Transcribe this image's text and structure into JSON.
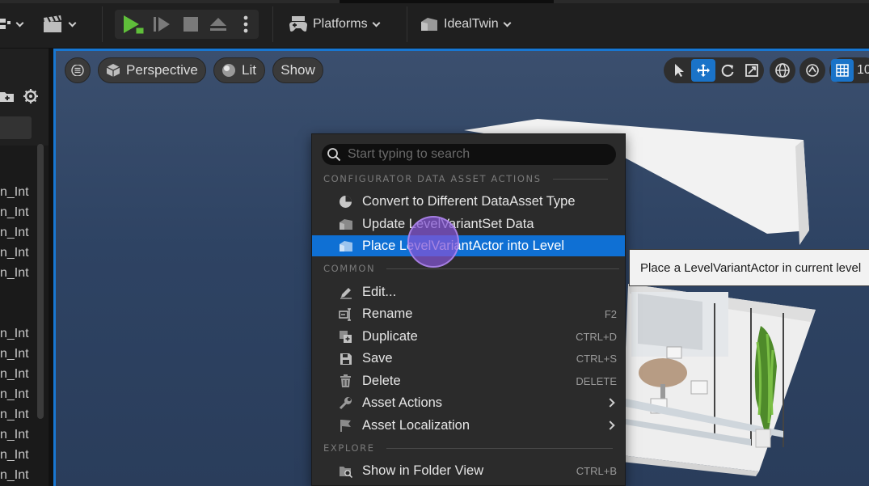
{
  "toolbar": {
    "platforms_label": "Platforms",
    "project_label": "IdealTwin"
  },
  "left_panel": {
    "rows": [
      "n_Int",
      "n_Int",
      "n_Int",
      "n_Int",
      "n_Int",
      "n_Int",
      "n_Int",
      "n_Int",
      "n_Int",
      "n_Int",
      "n_Int",
      "n_Int",
      "n_Int"
    ]
  },
  "viewport": {
    "view_mode": "Perspective",
    "lighting_mode": "Lit",
    "show_label": "Show",
    "grid_value": "10"
  },
  "context_menu": {
    "search_placeholder": "Start typing to search",
    "sections": {
      "configurator": "CONFIGURATOR DATA ASSET ACTIONS",
      "common": "COMMON",
      "explore": "EXPLORE"
    },
    "configurator_items": [
      {
        "label": "Convert to Different DataAsset Type",
        "icon": "pie-chart-icon"
      },
      {
        "label": "Update LevelVariantSet Data",
        "icon": "level-variant-icon"
      },
      {
        "label": "Place LevelVariantActor into Level",
        "icon": "level-variant-icon"
      }
    ],
    "common_items": [
      {
        "label": "Edit...",
        "shortcut": "",
        "icon": "pencil-icon"
      },
      {
        "label": "Rename",
        "shortcut": "F2",
        "icon": "rename-icon"
      },
      {
        "label": "Duplicate",
        "shortcut": "CTRL+D",
        "icon": "duplicate-icon"
      },
      {
        "label": "Save",
        "shortcut": "CTRL+S",
        "icon": "save-icon"
      },
      {
        "label": "Delete",
        "shortcut": "DELETE",
        "icon": "trash-icon"
      },
      {
        "label": "Asset Actions",
        "shortcut": "",
        "icon": "wrench-icon"
      },
      {
        "label": "Asset Localization",
        "shortcut": "",
        "icon": "flag-icon"
      }
    ],
    "explore_items": [
      {
        "label": "Show in Folder View",
        "shortcut": "CTRL+B",
        "icon": "folder-search-icon"
      }
    ]
  },
  "tooltip": {
    "text": "Place a LevelVariantActor in current level"
  },
  "colors": {
    "highlight": "#0f70d4",
    "viewport_border": "#1877d2",
    "cursor_ring": "#8454d6"
  }
}
